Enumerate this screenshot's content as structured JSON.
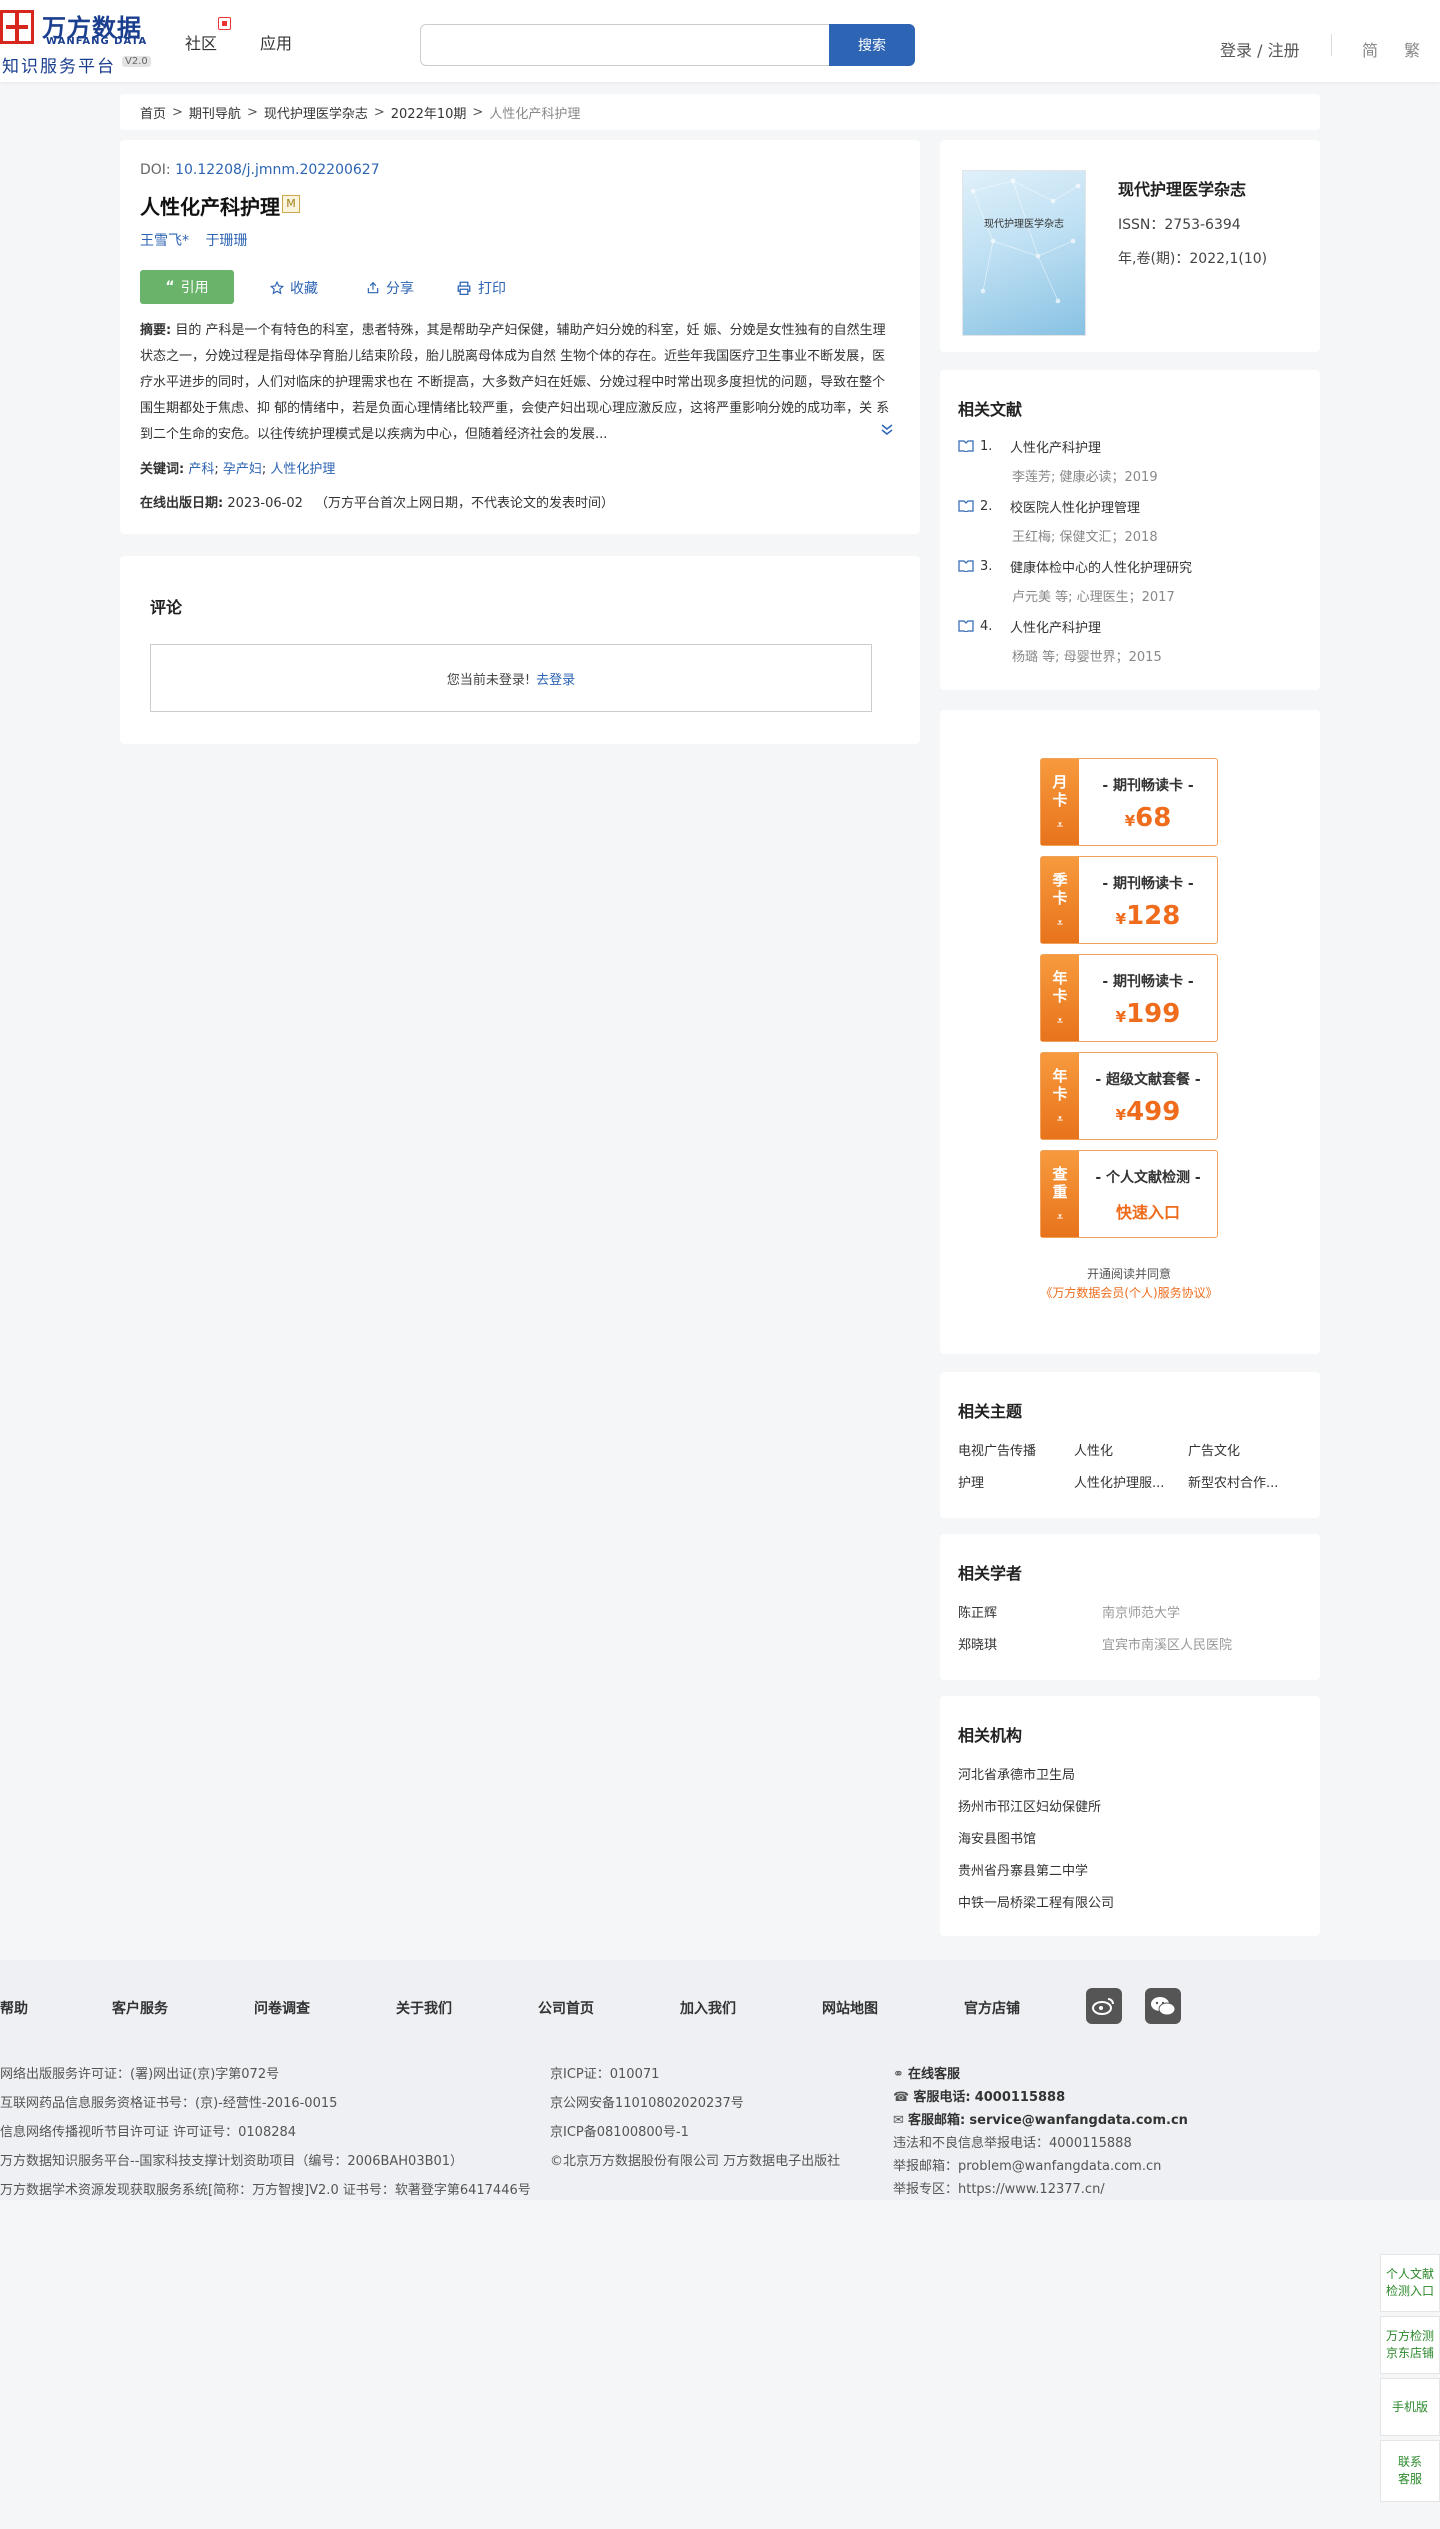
{
  "header": {
    "logo_cn": "万方数据",
    "logo_en": "WANFANG DATA",
    "logo_sub": "知识服务平台",
    "logo_version": "V2.0",
    "nav": [
      "社区",
      "应用"
    ],
    "search_placeholder": "",
    "search_button": "搜索",
    "login": "登录 / 注册",
    "lang_simplified": "简",
    "lang_traditional": "繁"
  },
  "breadcrumb": {
    "items": [
      "首页",
      "期刊导航",
      "现代护理医学杂志",
      "2022年10期"
    ],
    "current": "人性化产科护理"
  },
  "article": {
    "doi_label": "DOI:",
    "doi": "10.12208/j.jmnm.202200627",
    "title": "人性化产科护理",
    "badge": "M",
    "authors": [
      "王雪飞*",
      "于珊珊"
    ],
    "actions": {
      "cite": "引用",
      "favorite": "收藏",
      "share": "分享",
      "print": "打印"
    },
    "abstract_label": "摘要:",
    "abstract": "目的 产科是一个有特色的科室，患者特殊，其是帮助孕产妇保健，辅助产妇分娩的科室，妊 娠、分娩是女性独有的自然生理状态之一，分娩过程是指母体孕育胎儿结束阶段，胎儿脱离母体成为自然 生物个体的存在。近些年我国医疗卫生事业不断发展，医疗水平进步的同时，人们对临床的护理需求也在 不断提高，大多数产妇在妊娠、分娩过程中时常出现多度担忧的问题，导致在整个围生期都处于焦虑、抑 郁的情绪中，若是负面心理情绪比较严重，会使产妇出现心理应激反应，这将严重影响分娩的成功率，关 系到二个生命的安危。以往传统护理模式是以疾病为中心，但随着经济社会的发展...",
    "keywords_label": "关键词:",
    "keywords": [
      "产科",
      "孕产妇",
      "人性化护理"
    ],
    "pubdate_label": "在线出版日期:",
    "pubdate": "2023-06-02",
    "pubdate_note": "（万方平台首次上网日期，不代表论文的发表时间）"
  },
  "comments": {
    "title": "评论",
    "not_logged": "您当前未登录!",
    "login_link": "去登录"
  },
  "journal": {
    "cover_title": "现代护理医学杂志",
    "name": "现代护理医学杂志",
    "issn": "ISSN：2753-6394",
    "year_issue": "年,卷(期)：2022,1(10)"
  },
  "related_docs": {
    "title": "相关文献",
    "items": [
      {
        "num": "1.",
        "title": "人性化产科护理",
        "meta": "李莲芳; 健康必读；2019"
      },
      {
        "num": "2.",
        "title": "校医院人性化护理管理",
        "meta": "王红梅; 保健文汇；2018"
      },
      {
        "num": "3.",
        "title": "健康体检中心的人性化护理研究",
        "meta": "卢元美  等; 心理医生；2017"
      },
      {
        "num": "4.",
        "title": "人性化产科护理",
        "meta": "杨璐  等; 母婴世界；2015"
      }
    ]
  },
  "promo": {
    "cards": [
      {
        "tag": [
          "月",
          "卡"
        ],
        "name": "- 期刊畅读卡 -",
        "currency": "¥",
        "price": "68"
      },
      {
        "tag": [
          "季",
          "卡"
        ],
        "name": "- 期刊畅读卡 -",
        "currency": "¥",
        "price": "128"
      },
      {
        "tag": [
          "年",
          "卡"
        ],
        "name": "- 期刊畅读卡 -",
        "currency": "¥",
        "price": "199"
      },
      {
        "tag": [
          "年",
          "卡"
        ],
        "name": "- 超级文献套餐 -",
        "currency": "¥",
        "price": "499"
      },
      {
        "tag": [
          "查",
          "重"
        ],
        "name": "- 个人文献检测 -",
        "link": "快速入口"
      }
    ],
    "arrow": "⩡",
    "note": "开通阅读并同意",
    "agreement": "《万方数据会员(个人)服务协议》"
  },
  "topics": {
    "title": "相关主题",
    "items": [
      "电视广告传播",
      "人性化",
      "广告文化",
      "护理",
      "人性化护理服...",
      "新型农村合作..."
    ]
  },
  "scholars": {
    "title": "相关学者",
    "items": [
      {
        "name": "陈正辉",
        "org": "南京师范大学"
      },
      {
        "name": "郑晓琪",
        "org": "宜宾市南溪区人民医院"
      }
    ]
  },
  "orgs": {
    "title": "相关机构",
    "items": [
      "河北省承德市卫生局",
      "扬州市邗江区妇幼保健所",
      "海安县图书馆",
      "贵州省丹寨县第二中学",
      "中铁一局桥梁工程有限公司"
    ]
  },
  "footer": {
    "nav": [
      "帮助",
      "客户服务",
      "问卷调查",
      "关于我们",
      "公司首页",
      "加入我们",
      "网站地图",
      "官方店铺"
    ],
    "col1": [
      "网络出版服务许可证：(署)网出证(京)字第072号",
      "互联网药品信息服务资格证书号：(京)-经营性-2016-0015",
      "信息网络传播视听节目许可证 许可证号：0108284",
      "万方数据知识服务平台--国家科技支撑计划资助项目（编号：2006BAH03B01）",
      "万方数据学术资源发现获取服务系统[简称：万方智搜]V2.0 证书号：软著登字第6417446号"
    ],
    "col2": [
      "京ICP证：010071",
      "京公网安备11010802020237号",
      "京ICP备08100800号-1",
      "©北京万方数据股份有限公司 万方数据电子出版社"
    ],
    "online_service": "在线客服",
    "phone_label": "客服电话:",
    "phone": "4000115888",
    "email_label": "客服邮箱:",
    "email": "service@wanfangdata.com.cn",
    "report_phone": "违法和不良信息举报电话：4000115888",
    "report_email": "举报邮箱：problem@wanfangdata.com.cn",
    "report_area": "举报专区：https://www.12377.cn/"
  },
  "side_float": [
    [
      "个人文献",
      "检测入口"
    ],
    [
      "万方检测",
      "京东店铺"
    ],
    [
      "手机版"
    ],
    [
      "联系",
      "客服"
    ]
  ]
}
